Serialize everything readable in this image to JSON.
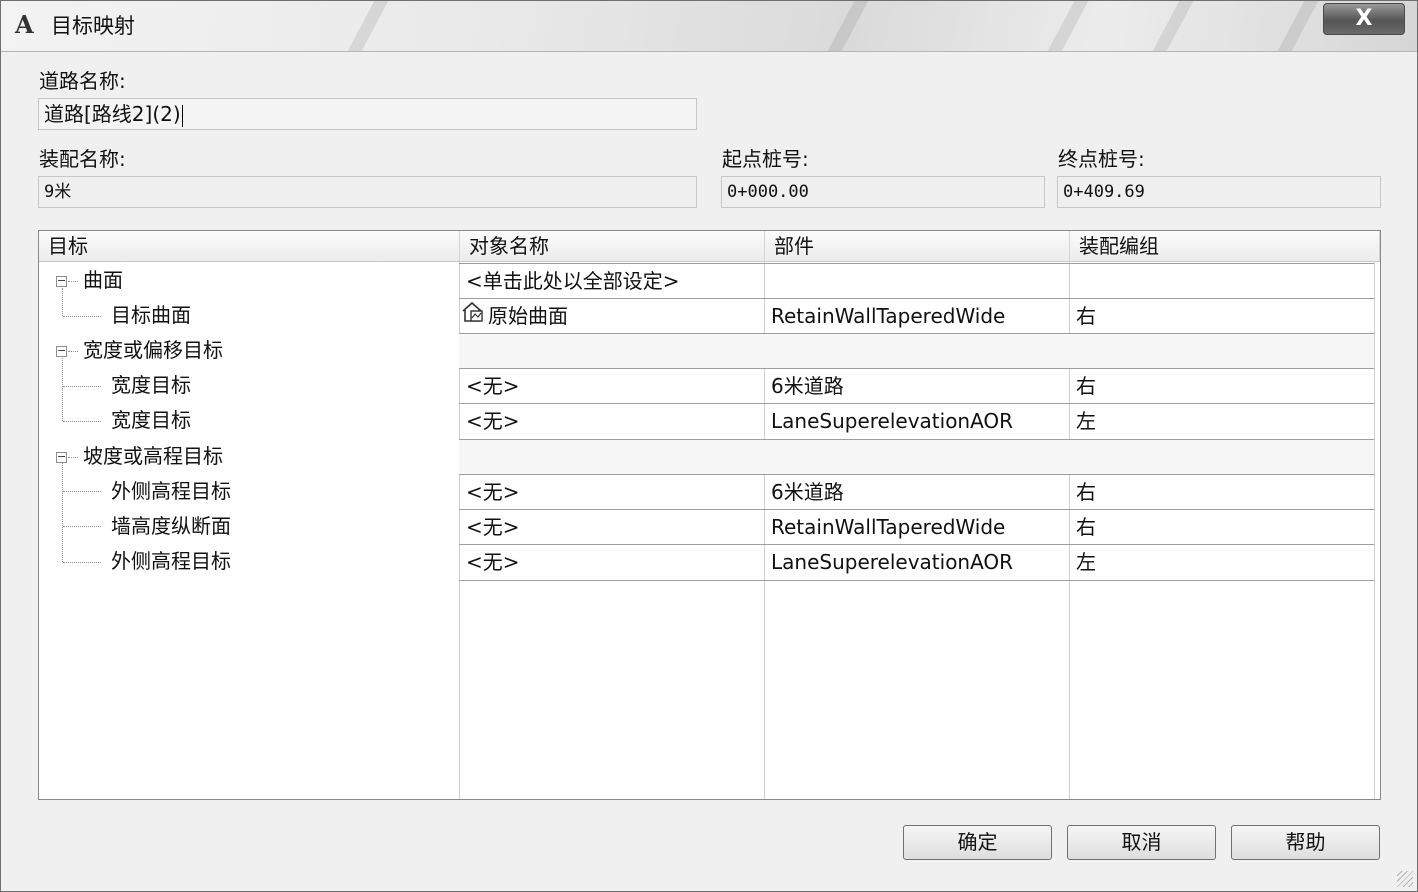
{
  "window": {
    "title": "目标映射",
    "app_icon": "autocad-a-icon",
    "close_label": "X"
  },
  "form": {
    "corridor_name_label": "道路名称:",
    "corridor_name_value": "道路[路线2](2)",
    "assembly_name_label": "装配名称:",
    "assembly_name_value": "9米",
    "start_station_label": "起点桩号:",
    "start_station_value": "0+000.00",
    "end_station_label": "终点桩号:",
    "end_station_value": "0+409.69"
  },
  "grid": {
    "columns": [
      "目标",
      "对象名称",
      "部件",
      "装配编组"
    ],
    "tree": [
      {
        "label": "曲面",
        "level": 0,
        "group": true
      },
      {
        "label": "目标曲面",
        "level": 1
      },
      {
        "label": "宽度或偏移目标",
        "level": 0,
        "group": true
      },
      {
        "label": "宽度目标",
        "level": 1
      },
      {
        "label": "宽度目标",
        "level": 1
      },
      {
        "label": "坡度或高程目标",
        "level": 0,
        "group": true
      },
      {
        "label": "外侧高程目标",
        "level": 1
      },
      {
        "label": "墙高度纵断面",
        "level": 1
      },
      {
        "label": "外侧高程目标",
        "level": 1
      }
    ],
    "rows": [
      {
        "object": "<单击此处以全部设定>",
        "subassembly": "",
        "group": ""
      },
      {
        "object": "原始曲面",
        "subassembly": "RetainWallTaperedWide",
        "group": "右",
        "icon": "surface-icon"
      },
      {
        "object": "",
        "subassembly": "",
        "group": ""
      },
      {
        "object": "<无>",
        "subassembly": "6米道路",
        "group": "右"
      },
      {
        "object": "<无>",
        "subassembly": "LaneSuperelevationAOR",
        "group": "左"
      },
      {
        "object": "",
        "subassembly": "",
        "group": ""
      },
      {
        "object": "<无>",
        "subassembly": "6米道路",
        "group": "右"
      },
      {
        "object": "<无>",
        "subassembly": "RetainWallTaperedWide",
        "group": "右"
      },
      {
        "object": "<无>",
        "subassembly": "LaneSuperelevationAOR",
        "group": "左"
      }
    ]
  },
  "buttons": {
    "ok": "确定",
    "cancel": "取消",
    "help": "帮助"
  }
}
